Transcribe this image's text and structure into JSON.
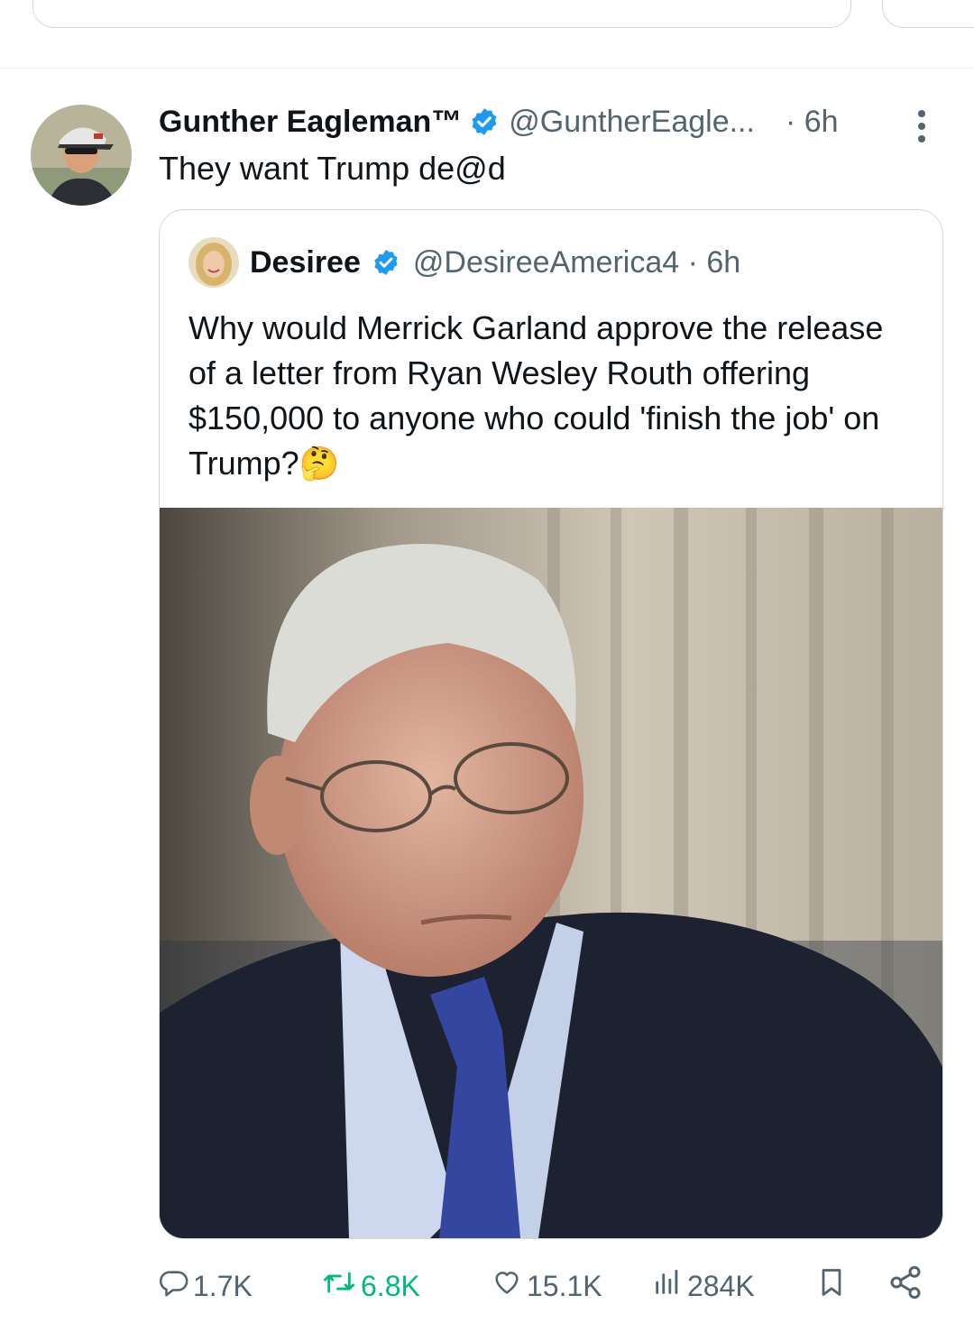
{
  "tweet": {
    "author_name": "Gunther Eagleman™",
    "handle": "@GuntherEagle...",
    "time": "· 6h",
    "text": "They want Trump de@d"
  },
  "quote": {
    "author_name": "Desiree",
    "handle_time": "@DesireeAmerica4 · 6h",
    "text": "Why would Merrick Garland approve the release of a letter from Ryan Wesley Routh offering $150,000 to anyone who could 'finish the job' on Trump?🤔"
  },
  "actions": {
    "replies": "1.7K",
    "reposts": "6.8K",
    "likes": "15.1K",
    "views": "284K"
  },
  "colors": {
    "verified": "#1d9bf0",
    "repost_active": "#00ba7c",
    "secondary_text": "#536471"
  },
  "icons": [
    "verified-badge-icon",
    "more-icon",
    "reply-icon",
    "repost-icon",
    "like-icon",
    "views-icon",
    "bookmark-icon",
    "share-icon"
  ]
}
